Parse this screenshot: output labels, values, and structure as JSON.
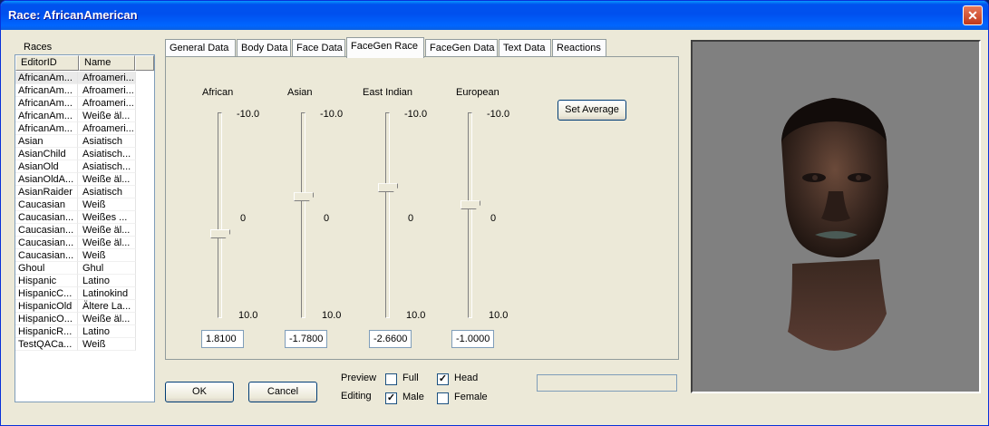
{
  "window": {
    "title": "Race: AfricanAmerican",
    "close_icon": "close-icon"
  },
  "races": {
    "label": "Races",
    "columns": [
      "EditorID",
      "Name"
    ],
    "rows": [
      [
        "AfricanAm...",
        "Afroameri..."
      ],
      [
        "AfricanAm...",
        "Afroameri..."
      ],
      [
        "AfricanAm...",
        "Afroameri..."
      ],
      [
        "AfricanAm...",
        "Weiße äl..."
      ],
      [
        "AfricanAm...",
        "Afroameri..."
      ],
      [
        "Asian",
        "Asiatisch"
      ],
      [
        "AsianChild",
        "Asiatisch..."
      ],
      [
        "AsianOld",
        "Asiatisch..."
      ],
      [
        "AsianOldA...",
        "Weiße äl..."
      ],
      [
        "AsianRaider",
        "Asiatisch"
      ],
      [
        "Caucasian",
        "Weiß"
      ],
      [
        "Caucasian...",
        "Weißes ..."
      ],
      [
        "Caucasian...",
        "Weiße äl..."
      ],
      [
        "Caucasian...",
        "Weiße äl..."
      ],
      [
        "Caucasian...",
        "Weiß"
      ],
      [
        "Ghoul",
        "Ghul"
      ],
      [
        "Hispanic",
        "Latino"
      ],
      [
        "HispanicC...",
        "Latinokind"
      ],
      [
        "HispanicOld",
        "Ältere La..."
      ],
      [
        "HispanicO...",
        "Weiße äl..."
      ],
      [
        "HispanicR...",
        "Latino"
      ],
      [
        "TestQACa...",
        "Weiß"
      ]
    ]
  },
  "tabs": [
    "General Data",
    "Body Data",
    "Face Data",
    "FaceGen Race",
    "FaceGen Data",
    "Text Data",
    "Reactions"
  ],
  "active_tab": "FaceGen Race",
  "sliders": [
    {
      "name": "African",
      "top": "-10.0",
      "mid": "0",
      "bottom": "10.0",
      "value": "1.8100",
      "level": 1.81
    },
    {
      "name": "Asian",
      "top": "-10.0",
      "mid": "0",
      "bottom": "10.0",
      "value": "-1.7800",
      "level": -1.78
    },
    {
      "name": "East Indian",
      "top": "-10.0",
      "mid": "0",
      "bottom": "10.0",
      "value": "-2.6600",
      "level": -2.66
    },
    {
      "name": "European",
      "top": "-10.0",
      "mid": "0",
      "bottom": "10.0",
      "value": "-1.0000",
      "level": -1.0
    }
  ],
  "set_average_label": "Set Average",
  "ok_label": "OK",
  "cancel_label": "Cancel",
  "preview": {
    "label": "Preview",
    "full_label": "Full",
    "full_checked": false,
    "head_label": "Head",
    "head_checked": true
  },
  "editing": {
    "label": "Editing",
    "male_label": "Male",
    "male_checked": true,
    "female_label": "Female",
    "female_checked": false
  },
  "colors": {
    "titlebar": "#0054e3",
    "face_bg": "#808080",
    "dialog": "#ece9d8"
  }
}
